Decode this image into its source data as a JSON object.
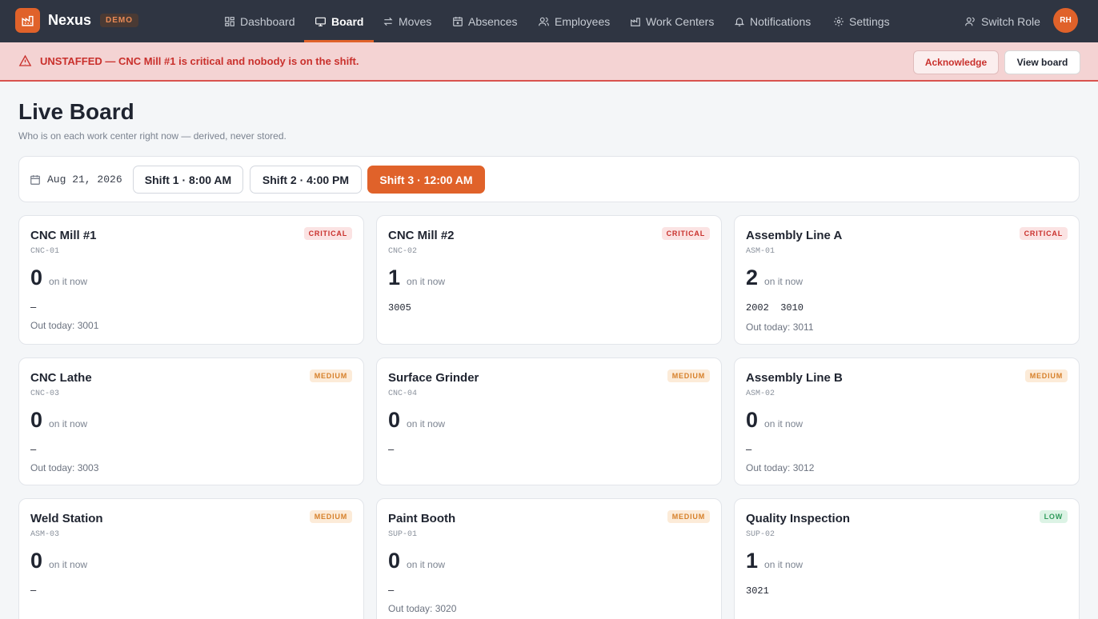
{
  "brand": {
    "name": "Nexus",
    "badge": "DEMO"
  },
  "nav": [
    {
      "label": "Dashboard",
      "icon": "dashboard-icon"
    },
    {
      "label": "Board",
      "icon": "monitor-icon",
      "active": true
    },
    {
      "label": "Moves",
      "icon": "swap-icon"
    },
    {
      "label": "Absences",
      "icon": "calendar-x-icon"
    },
    {
      "label": "Employees",
      "icon": "users-icon"
    },
    {
      "label": "Work Centers",
      "icon": "factory-icon"
    },
    {
      "label": "Notifications",
      "icon": "bell-icon"
    },
    {
      "label": "Settings",
      "icon": "gear-icon"
    }
  ],
  "user": {
    "switch_role": "Switch Role",
    "initials": "RH"
  },
  "alert": {
    "message": "UNSTAFFED — CNC Mill #1 is critical and nobody is on the shift.",
    "acknowledge": "Acknowledge",
    "view_board": "View board"
  },
  "page": {
    "title": "Live Board",
    "subtitle": "Who is on each work center right now — derived, never stored."
  },
  "shifts": {
    "date": "Aug 21, 2026",
    "options": [
      "Shift 1 · 8:00 AM",
      "Shift 2 · 4:00 PM",
      "Shift 3 · 12:00 AM"
    ],
    "selected": "Shift 3 · 12:00 AM"
  },
  "on_it_now_label": "on it now",
  "cards": [
    {
      "name": "CNC Mill #1",
      "code": "CNC-01",
      "priority": "CRITICAL",
      "count": "0",
      "people": "–",
      "out_today": "Out today: 3001"
    },
    {
      "name": "CNC Mill #2",
      "code": "CNC-02",
      "priority": "CRITICAL",
      "count": "1",
      "people": "3005",
      "out_today": ""
    },
    {
      "name": "Assembly Line A",
      "code": "ASM-01",
      "priority": "CRITICAL",
      "count": "2",
      "people": "2002  3010",
      "out_today": "Out today: 3011"
    },
    {
      "name": "CNC Lathe",
      "code": "CNC-03",
      "priority": "MEDIUM",
      "count": "0",
      "people": "–",
      "out_today": "Out today: 3003"
    },
    {
      "name": "Surface Grinder",
      "code": "CNC-04",
      "priority": "MEDIUM",
      "count": "0",
      "people": "–",
      "out_today": ""
    },
    {
      "name": "Assembly Line B",
      "code": "ASM-02",
      "priority": "MEDIUM",
      "count": "0",
      "people": "–",
      "out_today": "Out today: 3012"
    },
    {
      "name": "Weld Station",
      "code": "ASM-03",
      "priority": "MEDIUM",
      "count": "0",
      "people": "–",
      "out_today": ""
    },
    {
      "name": "Paint Booth",
      "code": "SUP-01",
      "priority": "MEDIUM",
      "count": "0",
      "people": "–",
      "out_today": "Out today: 3020"
    },
    {
      "name": "Quality Inspection",
      "code": "SUP-02",
      "priority": "LOW",
      "count": "1",
      "people": "3021",
      "out_today": ""
    }
  ],
  "colors": {
    "accent": "#e0622a",
    "topbar": "#2f3542",
    "alert_bg": "#f4d3d3",
    "critical": "#c9302c",
    "medium": "#d6802a",
    "low": "#2f9a5b"
  }
}
